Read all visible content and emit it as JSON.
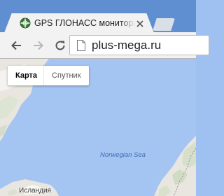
{
  "tab": {
    "title": "GPS ГЛОНАСС мониторинг",
    "favicon": "globe-icon",
    "close": "close-icon"
  },
  "toolbar": {
    "back": "back-arrow-icon",
    "forward": "forward-arrow-icon",
    "reload": "reload-icon",
    "url": "plus-mega.ru",
    "page_icon": "page-icon"
  },
  "map": {
    "type_buttons": [
      "Карта",
      "Спутник"
    ],
    "selected_type": "Карта",
    "sea_label": "Norwegian Sea",
    "land_label": "Исландия"
  },
  "colors": {
    "tabstrip": "#5f8fd0",
    "toolbar": "#f2f2f2",
    "water": "#a4c4f2",
    "land": "#e8e6df"
  }
}
